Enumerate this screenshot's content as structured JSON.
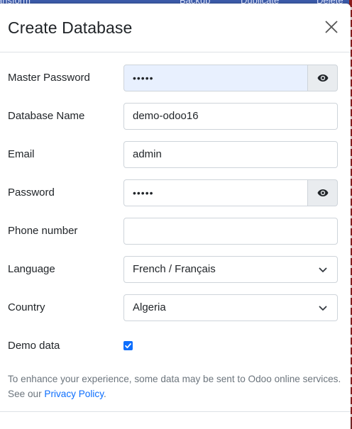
{
  "background": {
    "toolbar_items": [
      "ansform",
      "Backup",
      "Duplicate",
      "Delete"
    ]
  },
  "modal": {
    "title": "Create Database",
    "close_icon": "close-icon"
  },
  "form": {
    "master_password": {
      "label": "Master Password",
      "value": "•••••"
    },
    "database_name": {
      "label": "Database Name",
      "value": "demo-odoo16"
    },
    "email": {
      "label": "Email",
      "value": "admin"
    },
    "password": {
      "label": "Password",
      "value": "•••••"
    },
    "phone": {
      "label": "Phone number",
      "value": ""
    },
    "language": {
      "label": "Language",
      "value": "French / Français"
    },
    "country": {
      "label": "Country",
      "value": "Algeria"
    },
    "demo_data": {
      "label": "Demo data",
      "checked": true
    }
  },
  "notice": {
    "text": "To enhance your experience, some data may be sent to Odoo online services. See our ",
    "link": "Privacy Policy",
    "end": "."
  },
  "colors": {
    "accent": "#0d6efd",
    "autofill": "#e8f0fe",
    "muted": "#6c757d"
  }
}
